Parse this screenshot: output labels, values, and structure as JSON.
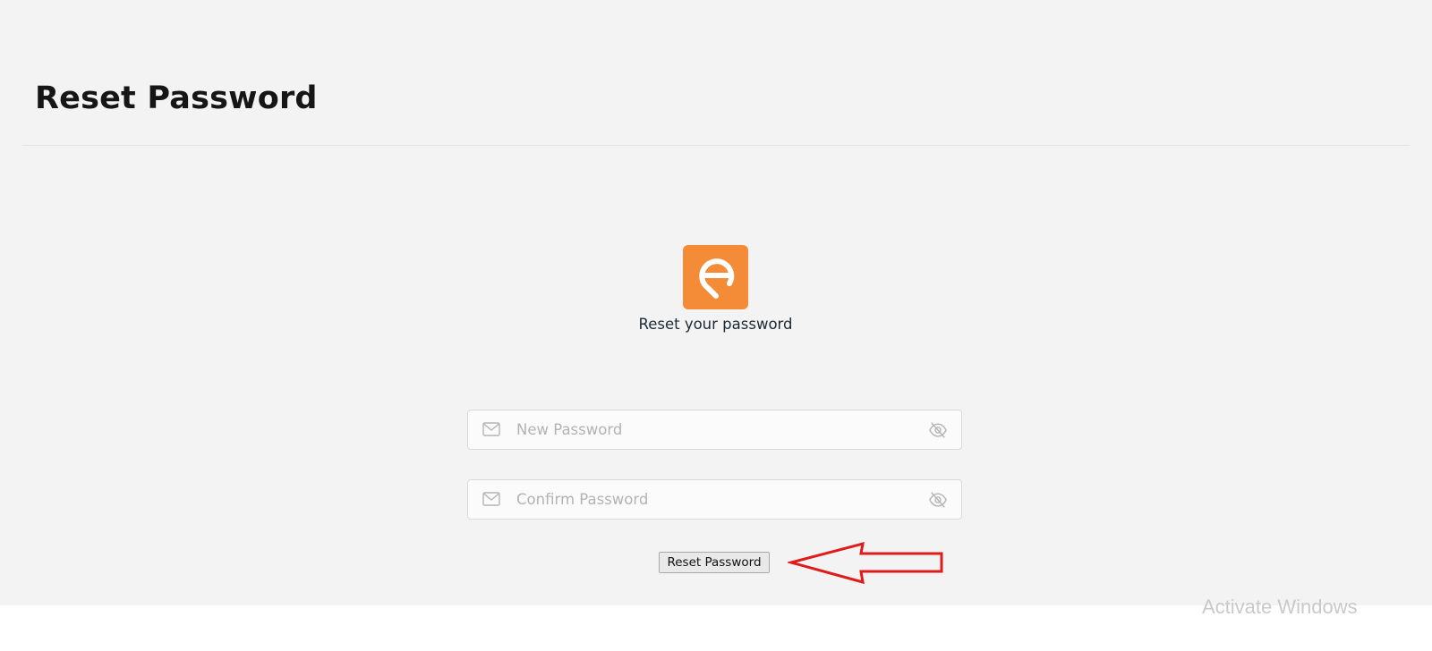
{
  "header": {
    "title": "Reset Password"
  },
  "brand": {
    "logo_icon": "location-pin-e-logo",
    "logo_color": "#f48c37"
  },
  "form": {
    "subtitle": "Reset your password",
    "new_password": {
      "placeholder": "New Password",
      "value": "",
      "leading_icon": "mail-icon",
      "trailing_icon": "eye-slash-icon"
    },
    "confirm_password": {
      "placeholder": "Confirm Password",
      "value": "",
      "leading_icon": "mail-icon",
      "trailing_icon": "eye-slash-icon"
    },
    "submit_label": "Reset Password"
  },
  "annotation": {
    "icon": "red-arrow-left-outline",
    "color": "#e01b1b"
  },
  "watermark": {
    "text": "Activate Windows"
  }
}
